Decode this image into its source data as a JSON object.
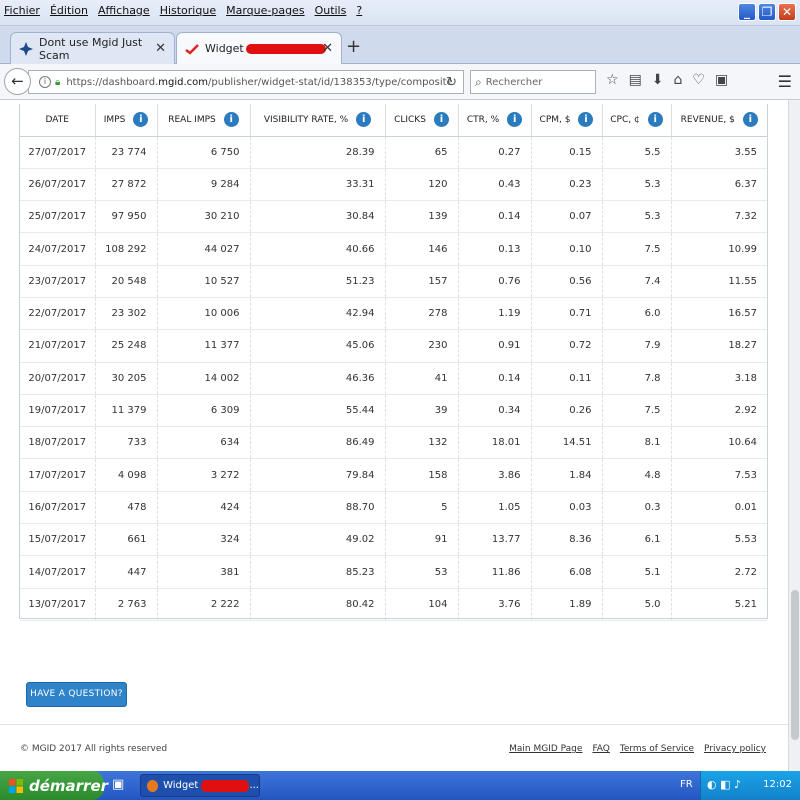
{
  "menubar": {
    "items": [
      "Fichier",
      "Édition",
      "Affichage",
      "Historique",
      "Marque-pages",
      "Outils",
      "?"
    ]
  },
  "tabs": [
    {
      "title": "Dont use Mgid Just Scam",
      "active": false
    },
    {
      "title": "Widget",
      "active": true
    }
  ],
  "navbar": {
    "url_prefix": "https://dashboard.",
    "url_host": "mgid.com",
    "url_path": "/publisher/widget-stat/id/138353/type/composite",
    "search_placeholder": "Rechercher"
  },
  "table": {
    "headers": [
      "DATE",
      "IMPS",
      "REAL IMPS",
      "VISIBILITY RATE, %",
      "CLICKS",
      "CTR, %",
      "CPM, $",
      "CPC, ¢",
      "REVENUE, $"
    ],
    "rows": [
      [
        "27/07/2017",
        "23 774",
        "6 750",
        "28.39",
        "65",
        "0.27",
        "0.15",
        "5.5",
        "3.55"
      ],
      [
        "26/07/2017",
        "27 872",
        "9 284",
        "33.31",
        "120",
        "0.43",
        "0.23",
        "5.3",
        "6.37"
      ],
      [
        "25/07/2017",
        "97 950",
        "30 210",
        "30.84",
        "139",
        "0.14",
        "0.07",
        "5.3",
        "7.32"
      ],
      [
        "24/07/2017",
        "108 292",
        "44 027",
        "40.66",
        "146",
        "0.13",
        "0.10",
        "7.5",
        "10.99"
      ],
      [
        "23/07/2017",
        "20 548",
        "10 527",
        "51.23",
        "157",
        "0.76",
        "0.56",
        "7.4",
        "11.55"
      ],
      [
        "22/07/2017",
        "23 302",
        "10 006",
        "42.94",
        "278",
        "1.19",
        "0.71",
        "6.0",
        "16.57"
      ],
      [
        "21/07/2017",
        "25 248",
        "11 377",
        "45.06",
        "230",
        "0.91",
        "0.72",
        "7.9",
        "18.27"
      ],
      [
        "20/07/2017",
        "30 205",
        "14 002",
        "46.36",
        "41",
        "0.14",
        "0.11",
        "7.8",
        "3.18"
      ],
      [
        "19/07/2017",
        "11 379",
        "6 309",
        "55.44",
        "39",
        "0.34",
        "0.26",
        "7.5",
        "2.92"
      ],
      [
        "18/07/2017",
        "733",
        "634",
        "86.49",
        "132",
        "18.01",
        "14.51",
        "8.1",
        "10.64"
      ],
      [
        "17/07/2017",
        "4 098",
        "3 272",
        "79.84",
        "158",
        "3.86",
        "1.84",
        "4.8",
        "7.53"
      ],
      [
        "16/07/2017",
        "478",
        "424",
        "88.70",
        "5",
        "1.05",
        "0.03",
        "0.3",
        "0.01"
      ],
      [
        "15/07/2017",
        "661",
        "324",
        "49.02",
        "91",
        "13.77",
        "8.36",
        "6.1",
        "5.53"
      ],
      [
        "14/07/2017",
        "447",
        "381",
        "85.23",
        "53",
        "11.86",
        "6.08",
        "5.1",
        "2.72"
      ],
      [
        "13/07/2017",
        "2 763",
        "2 222",
        "80.42",
        "104",
        "3.76",
        "1.89",
        "5.0",
        "5.21"
      ]
    ]
  },
  "page": {
    "ask_button": "HAVE A QUESTION?",
    "copyright": "© MGID 2017 All rights reserved",
    "footer_links": [
      "Main MGID Page",
      "FAQ",
      "Terms of Service",
      "Privacy policy"
    ]
  },
  "taskbar": {
    "start_label": "démarrer",
    "task_label": "Widget",
    "task_suffix": "...",
    "lang": "FR",
    "clock": "12:02"
  },
  "colors": {
    "accent": "#2f83c8",
    "info_icon": "#2b7bbf",
    "redaction": "#e01010",
    "taskbar": "#2456c2",
    "start_button": "#2a8c2a"
  }
}
